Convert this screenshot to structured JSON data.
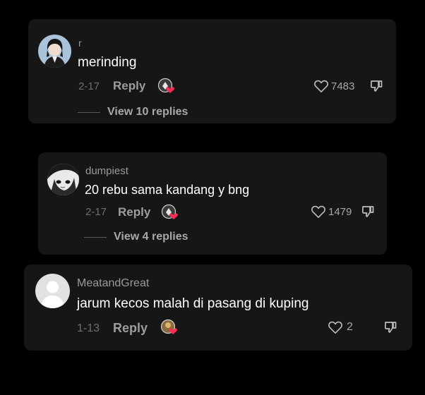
{
  "comments": [
    {
      "username": "r",
      "text": "merinding",
      "date": "2-17",
      "reply_label": "Reply",
      "likes": "7483",
      "view_replies": "View 10 replies",
      "avatar": "user-avatar-dark-hair"
    },
    {
      "username": "dumpiest",
      "text": "20 rebu sama kandang y bng",
      "date": "2-17",
      "reply_label": "Reply",
      "likes": "1479",
      "view_replies": "View 4 replies",
      "avatar": "user-avatar-manga"
    },
    {
      "username": "MeatandGreat",
      "text": "jarum kecos malah di pasang di kuping",
      "date": "1-13",
      "reply_label": "Reply",
      "likes": "2",
      "avatar": "user-avatar-default"
    }
  ],
  "colors": {
    "background": "#000000",
    "card": "#161616",
    "text": "#ffffff",
    "muted": "#9a9a9a",
    "heart_badge": "#fe2c55"
  },
  "icons": [
    "heart-outline-icon",
    "thumbs-down-icon",
    "creator-liked-heart-icon"
  ]
}
